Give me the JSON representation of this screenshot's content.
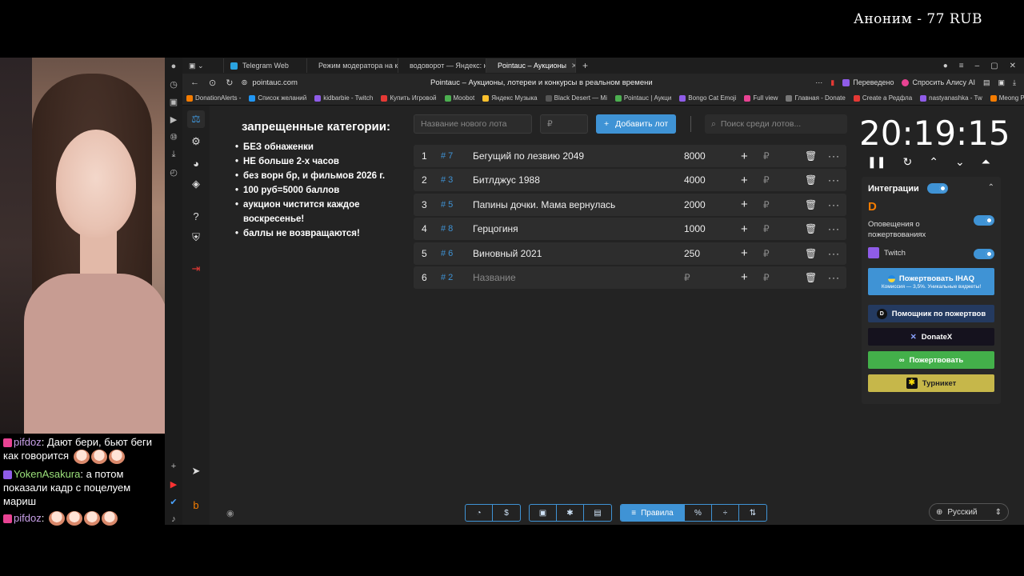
{
  "overlay": {
    "donation": "Аноним - 77 RUB"
  },
  "chat": {
    "messages": [
      {
        "user": "pifdoz",
        "text": "Дают бери, бьют беги как говорится",
        "emotes": 3
      },
      {
        "user": "YokenAsakura",
        "text": "а потом показали кадр с поцелуем мариш",
        "emotes": 0
      },
      {
        "user": "pifdoz",
        "text": "",
        "emotes": 4
      }
    ]
  },
  "browser": {
    "tabs": [
      {
        "label": "Telegram Web",
        "color": "#2aa3e0"
      },
      {
        "label": "Режим модератора на к",
        "color": "#8f5ce8"
      },
      {
        "label": "водоворот — Яндекс: наш",
        "color": "#e53935"
      },
      {
        "label": "Pointauc – Аукционы",
        "color": "#4caf50"
      }
    ],
    "url": "pointauc.com",
    "page_title": "Pointauc – Аукционы, лотереи и конкурсы в реальном времени",
    "translated": "Переведено",
    "ask_alice": "Спросить Алису AI",
    "bookmarks": [
      "DonationAlerts -",
      "Список желаний",
      "kidbarbie - Twitch",
      "Купить Игровой",
      "Moobot",
      "Яндекс Музыка",
      "Black Desert — Mi",
      "Pointauc | Аукци",
      "Bongo Cat Emoji",
      "Full view",
      "Главная - Donate",
      "Create a Редфла",
      "nastyanashka - Tw",
      "Meong Pa"
    ]
  },
  "rules": {
    "title": "запрещенные категории:",
    "items": [
      "БЕЗ обнаженки",
      "НЕ больше 2-х часов",
      "без ворн бр, и фильмов 2026 г.",
      "100 руб=5000 баллов",
      "аукцион чистится каждое воскресенье!",
      "баллы не возвращаются!"
    ]
  },
  "form": {
    "name_placeholder": "Название нового лота",
    "amount_placeholder": "₽",
    "add_label": "Добавить лот",
    "search_placeholder": "Поиск среди лотов..."
  },
  "lots": [
    {
      "n": "1",
      "id": "# 7",
      "name": "Бегущий по лезвию 2049",
      "amount": "8000"
    },
    {
      "n": "2",
      "id": "# 3",
      "name": "Битлджус 1988",
      "amount": "4000"
    },
    {
      "n": "3",
      "id": "# 5",
      "name": "Папины дочки. Мама вернулась",
      "amount": "2000"
    },
    {
      "n": "4",
      "id": "# 8",
      "name": "Герцогиня",
      "amount": "1000"
    },
    {
      "n": "5",
      "id": "# 6",
      "name": "Виновный 2021",
      "amount": "250"
    },
    {
      "n": "6",
      "id": "# 2",
      "name": "Название",
      "amount": "₽"
    }
  ],
  "timer": "20:19:15",
  "integrations": {
    "title": "Интеграции",
    "donation_alerts": "Оповещения о пожертвованиях",
    "twitch": "Twitch",
    "donate_ihaq": "Пожертвовать IHAQ",
    "donate_ihaq_sub": "Комиссия — 3,5%. Уникальные виджеты!",
    "helper": "Помощник по пожертвов",
    "donatex": "DonateX",
    "donate": "Пожертвовать",
    "turnstile": "Турникет"
  },
  "bottom": {
    "rules_label": "Правила",
    "language": "Русский"
  },
  "colors": {
    "accent": "#3f93d5",
    "bg": "#232323",
    "green": "#43b04a",
    "olive": "#c6b74a"
  }
}
